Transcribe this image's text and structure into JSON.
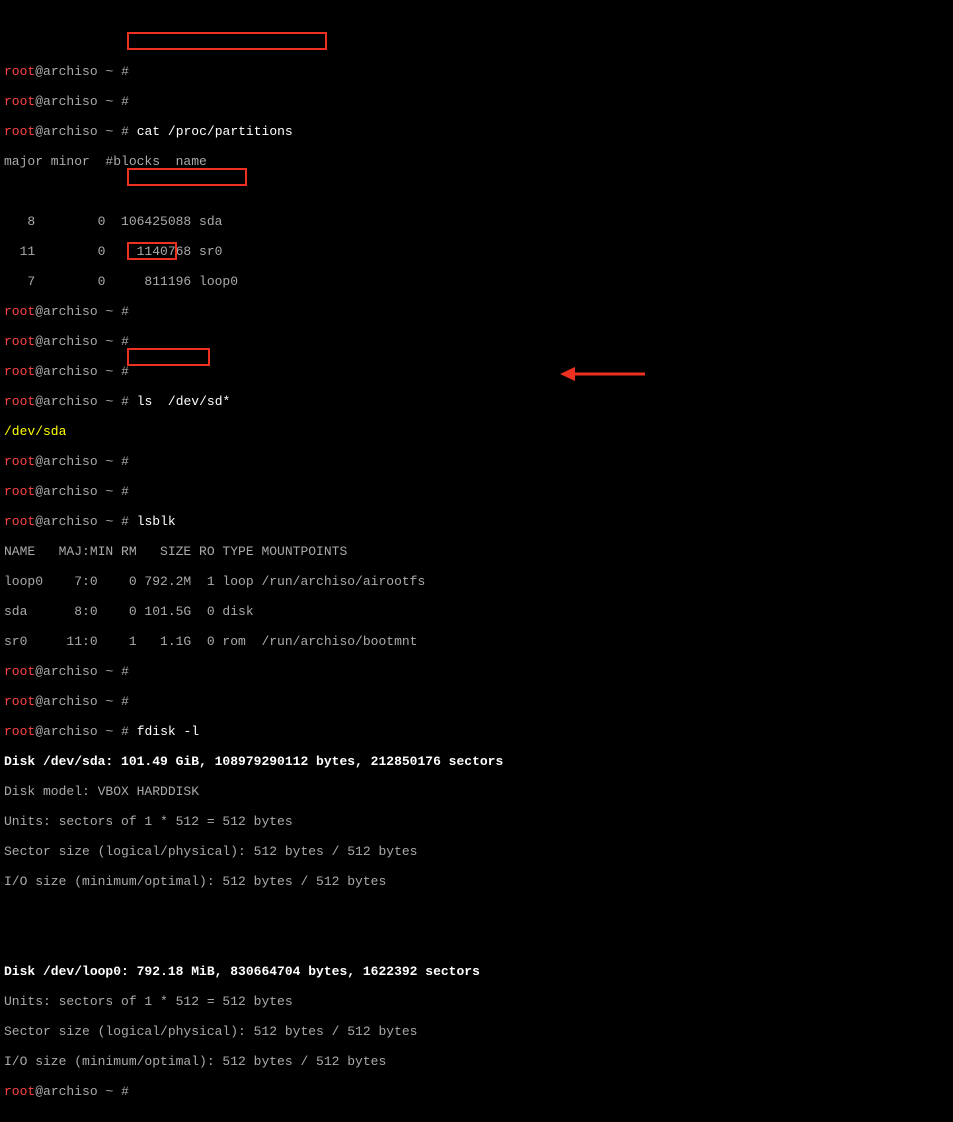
{
  "prompt": {
    "user": "root",
    "at": "@",
    "host": "archiso",
    "tilde": "~",
    "hash": "#"
  },
  "cmds": {
    "cat": "cat /proc/partitions",
    "ls": "ls  /dev/sd*",
    "lsblk": "lsblk",
    "fdisk": "fdisk -l"
  },
  "partitions": {
    "header": "major minor  #blocks  name",
    "rows": [
      "   8        0  106425088 sda",
      "  11        0    1140768 sr0",
      "   7        0     811196 loop0"
    ]
  },
  "ls_output": "/dev/sda",
  "lsblk": {
    "header": "NAME   MAJ:MIN RM   SIZE RO TYPE MOUNTPOINTS",
    "rows": [
      "loop0    7:0    0 792.2M  1 loop /run/archiso/airootfs",
      "sda      8:0    0 101.5G  0 disk",
      "sr0     11:0    1   1.1G  0 rom  /run/archiso/bootmnt"
    ]
  },
  "fdisk": {
    "disk1_line": "Disk /dev/sda: 101.49 GiB, 108979290112 bytes, 212850176 sectors",
    "disk1_info": [
      "Disk model: VBOX HARDDISK",
      "Units: sectors of 1 * 512 = 512 bytes",
      "Sector size (logical/physical): 512 bytes / 512 bytes",
      "I/O size (minimum/optimal): 512 bytes / 512 bytes"
    ],
    "disk2_line": "Disk /dev/loop0: 792.18 MiB, 830664704 bytes, 1622392 sectors",
    "disk2_info": [
      "Units: sectors of 1 * 512 = 512 bytes",
      "Sector size (logical/physical): 512 bytes / 512 bytes",
      "I/O size (minimum/optimal): 512 bytes / 512 bytes"
    ]
  }
}
